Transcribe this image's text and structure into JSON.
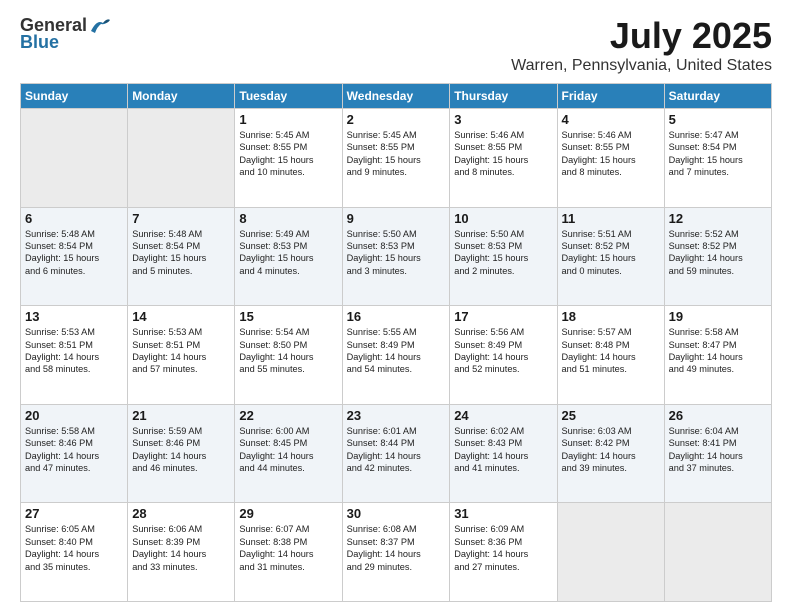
{
  "header": {
    "logo_general": "General",
    "logo_blue": "Blue",
    "title": "July 2025",
    "subtitle": "Warren, Pennsylvania, United States"
  },
  "days_of_week": [
    "Sunday",
    "Monday",
    "Tuesday",
    "Wednesday",
    "Thursday",
    "Friday",
    "Saturday"
  ],
  "weeks": [
    [
      {
        "day": "",
        "info": ""
      },
      {
        "day": "",
        "info": ""
      },
      {
        "day": "1",
        "info": "Sunrise: 5:45 AM\nSunset: 8:55 PM\nDaylight: 15 hours\nand 10 minutes."
      },
      {
        "day": "2",
        "info": "Sunrise: 5:45 AM\nSunset: 8:55 PM\nDaylight: 15 hours\nand 9 minutes."
      },
      {
        "day": "3",
        "info": "Sunrise: 5:46 AM\nSunset: 8:55 PM\nDaylight: 15 hours\nand 8 minutes."
      },
      {
        "day": "4",
        "info": "Sunrise: 5:46 AM\nSunset: 8:55 PM\nDaylight: 15 hours\nand 8 minutes."
      },
      {
        "day": "5",
        "info": "Sunrise: 5:47 AM\nSunset: 8:54 PM\nDaylight: 15 hours\nand 7 minutes."
      }
    ],
    [
      {
        "day": "6",
        "info": "Sunrise: 5:48 AM\nSunset: 8:54 PM\nDaylight: 15 hours\nand 6 minutes."
      },
      {
        "day": "7",
        "info": "Sunrise: 5:48 AM\nSunset: 8:54 PM\nDaylight: 15 hours\nand 5 minutes."
      },
      {
        "day": "8",
        "info": "Sunrise: 5:49 AM\nSunset: 8:53 PM\nDaylight: 15 hours\nand 4 minutes."
      },
      {
        "day": "9",
        "info": "Sunrise: 5:50 AM\nSunset: 8:53 PM\nDaylight: 15 hours\nand 3 minutes."
      },
      {
        "day": "10",
        "info": "Sunrise: 5:50 AM\nSunset: 8:53 PM\nDaylight: 15 hours\nand 2 minutes."
      },
      {
        "day": "11",
        "info": "Sunrise: 5:51 AM\nSunset: 8:52 PM\nDaylight: 15 hours\nand 0 minutes."
      },
      {
        "day": "12",
        "info": "Sunrise: 5:52 AM\nSunset: 8:52 PM\nDaylight: 14 hours\nand 59 minutes."
      }
    ],
    [
      {
        "day": "13",
        "info": "Sunrise: 5:53 AM\nSunset: 8:51 PM\nDaylight: 14 hours\nand 58 minutes."
      },
      {
        "day": "14",
        "info": "Sunrise: 5:53 AM\nSunset: 8:51 PM\nDaylight: 14 hours\nand 57 minutes."
      },
      {
        "day": "15",
        "info": "Sunrise: 5:54 AM\nSunset: 8:50 PM\nDaylight: 14 hours\nand 55 minutes."
      },
      {
        "day": "16",
        "info": "Sunrise: 5:55 AM\nSunset: 8:49 PM\nDaylight: 14 hours\nand 54 minutes."
      },
      {
        "day": "17",
        "info": "Sunrise: 5:56 AM\nSunset: 8:49 PM\nDaylight: 14 hours\nand 52 minutes."
      },
      {
        "day": "18",
        "info": "Sunrise: 5:57 AM\nSunset: 8:48 PM\nDaylight: 14 hours\nand 51 minutes."
      },
      {
        "day": "19",
        "info": "Sunrise: 5:58 AM\nSunset: 8:47 PM\nDaylight: 14 hours\nand 49 minutes."
      }
    ],
    [
      {
        "day": "20",
        "info": "Sunrise: 5:58 AM\nSunset: 8:46 PM\nDaylight: 14 hours\nand 47 minutes."
      },
      {
        "day": "21",
        "info": "Sunrise: 5:59 AM\nSunset: 8:46 PM\nDaylight: 14 hours\nand 46 minutes."
      },
      {
        "day": "22",
        "info": "Sunrise: 6:00 AM\nSunset: 8:45 PM\nDaylight: 14 hours\nand 44 minutes."
      },
      {
        "day": "23",
        "info": "Sunrise: 6:01 AM\nSunset: 8:44 PM\nDaylight: 14 hours\nand 42 minutes."
      },
      {
        "day": "24",
        "info": "Sunrise: 6:02 AM\nSunset: 8:43 PM\nDaylight: 14 hours\nand 41 minutes."
      },
      {
        "day": "25",
        "info": "Sunrise: 6:03 AM\nSunset: 8:42 PM\nDaylight: 14 hours\nand 39 minutes."
      },
      {
        "day": "26",
        "info": "Sunrise: 6:04 AM\nSunset: 8:41 PM\nDaylight: 14 hours\nand 37 minutes."
      }
    ],
    [
      {
        "day": "27",
        "info": "Sunrise: 6:05 AM\nSunset: 8:40 PM\nDaylight: 14 hours\nand 35 minutes."
      },
      {
        "day": "28",
        "info": "Sunrise: 6:06 AM\nSunset: 8:39 PM\nDaylight: 14 hours\nand 33 minutes."
      },
      {
        "day": "29",
        "info": "Sunrise: 6:07 AM\nSunset: 8:38 PM\nDaylight: 14 hours\nand 31 minutes."
      },
      {
        "day": "30",
        "info": "Sunrise: 6:08 AM\nSunset: 8:37 PM\nDaylight: 14 hours\nand 29 minutes."
      },
      {
        "day": "31",
        "info": "Sunrise: 6:09 AM\nSunset: 8:36 PM\nDaylight: 14 hours\nand 27 minutes."
      },
      {
        "day": "",
        "info": ""
      },
      {
        "day": "",
        "info": ""
      }
    ]
  ]
}
